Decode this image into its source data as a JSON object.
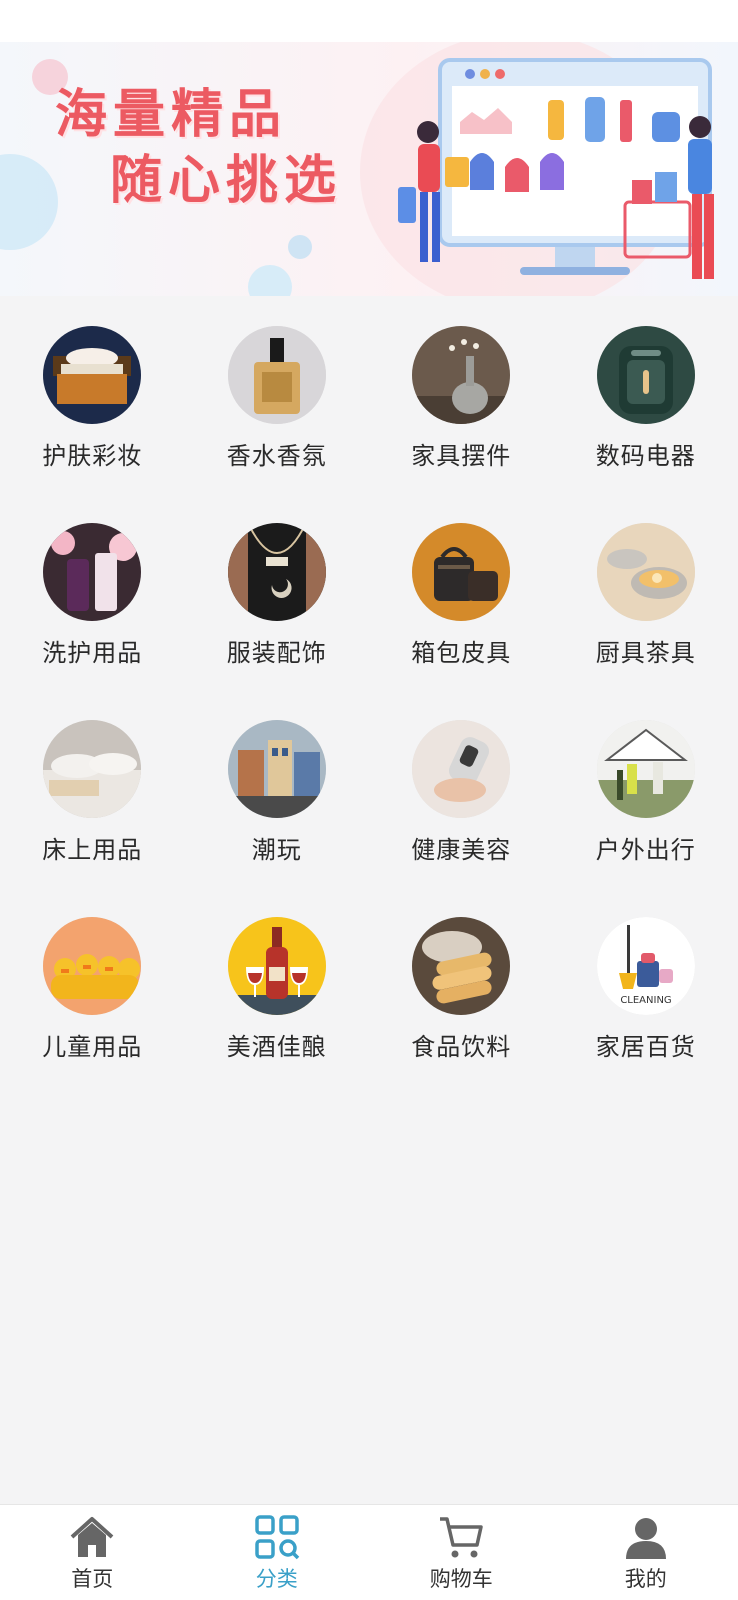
{
  "banner": {
    "line1": "海量精品",
    "line2": "随心挑选"
  },
  "categories": [
    {
      "label": "护肤彩妆",
      "icon": "skincare-thumb"
    },
    {
      "label": "香水香氛",
      "icon": "perfume-thumb"
    },
    {
      "label": "家具摆件",
      "icon": "vase-thumb"
    },
    {
      "label": "数码电器",
      "icon": "airfryer-thumb"
    },
    {
      "label": "洗护用品",
      "icon": "lotion-thumb"
    },
    {
      "label": "服装配饰",
      "icon": "necklace-thumb"
    },
    {
      "label": "箱包皮具",
      "icon": "bag-thumb"
    },
    {
      "label": "厨具茶具",
      "icon": "pot-thumb"
    },
    {
      "label": "床上用品",
      "icon": "bedding-thumb"
    },
    {
      "label": "潮玩",
      "icon": "lego-thumb"
    },
    {
      "label": "健康美容",
      "icon": "beauty-device-thumb"
    },
    {
      "label": "户外出行",
      "icon": "tent-thumb"
    },
    {
      "label": "儿童用品",
      "icon": "duck-thumb"
    },
    {
      "label": "美酒佳酿",
      "icon": "wine-thumb"
    },
    {
      "label": "食品饮料",
      "icon": "food-thumb"
    },
    {
      "label": "家居百货",
      "icon": "cleaning-thumb"
    }
  ],
  "cleaning_caption": "CLEANING",
  "tabbar": {
    "items": [
      {
        "label": "首页",
        "icon": "home-icon"
      },
      {
        "label": "分类",
        "icon": "category-icon",
        "active": true
      },
      {
        "label": "购物车",
        "icon": "cart-icon"
      },
      {
        "label": "我的",
        "icon": "user-icon"
      }
    ],
    "active_color": "#3aa0c8",
    "inactive_color": "#666666"
  }
}
